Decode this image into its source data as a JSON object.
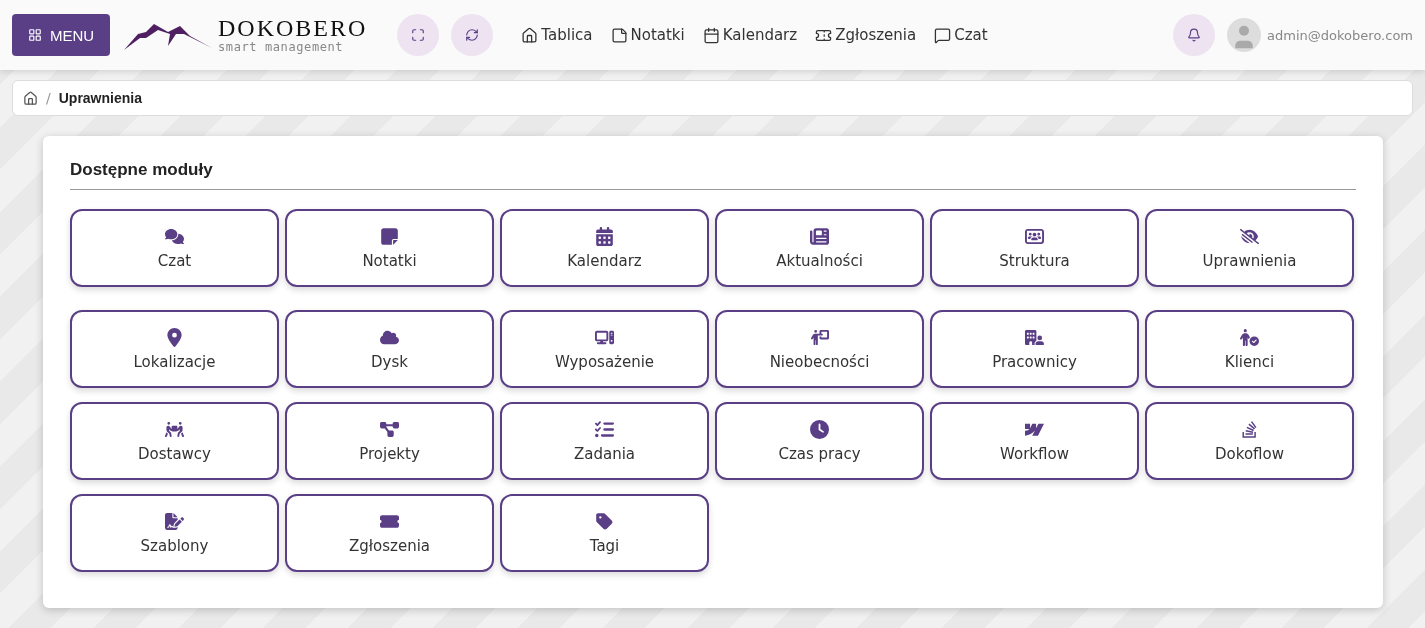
{
  "header": {
    "menu_button": "MENU",
    "logo": {
      "name": "DOKOBERO",
      "tagline": "smart management"
    },
    "nav": [
      {
        "label": "Tablica"
      },
      {
        "label": "Notatki"
      },
      {
        "label": "Kalendarz"
      },
      {
        "label": "Zgłoszenia"
      },
      {
        "label": "Czat"
      }
    ],
    "user": "admin@dokobero.com"
  },
  "breadcrumb": {
    "separator": "/",
    "current": "Uprawnienia"
  },
  "modules_panel": {
    "title": "Dostępne moduły",
    "rows": [
      [
        {
          "label": "Czat"
        },
        {
          "label": "Notatki"
        },
        {
          "label": "Kalendarz"
        },
        {
          "label": "Aktualności"
        },
        {
          "label": "Struktura"
        },
        {
          "label": "Uprawnienia"
        }
      ],
      [
        {
          "label": "Lokalizacje"
        },
        {
          "label": "Dysk"
        },
        {
          "label": "Wyposażenie"
        },
        {
          "label": "Nieobecności"
        },
        {
          "label": "Pracownicy"
        },
        {
          "label": "Klienci"
        },
        {
          "label": "Dostawcy"
        },
        {
          "label": "Projekty"
        },
        {
          "label": "Zadania"
        },
        {
          "label": "Czas pracy"
        },
        {
          "label": "Workflow"
        },
        {
          "label": "Dokoflow"
        },
        {
          "label": "Szablony"
        },
        {
          "label": "Zgłoszenia"
        },
        {
          "label": "Tagi"
        }
      ]
    ]
  }
}
